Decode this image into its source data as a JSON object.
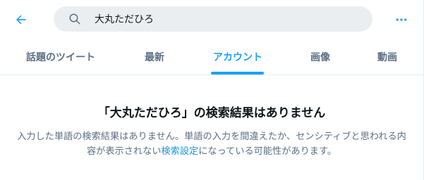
{
  "header": {
    "search_value": "大丸ただひろ",
    "back_icon": "arrow-left-icon",
    "more_icon": "more-horizontal-icon",
    "accent_color": "#1da1f2"
  },
  "tabs": [
    {
      "label": "話題のツイート",
      "active": false
    },
    {
      "label": "最新",
      "active": false
    },
    {
      "label": "アカウント",
      "active": true
    },
    {
      "label": "画像",
      "active": false
    },
    {
      "label": "動画",
      "active": false
    }
  ],
  "empty_state": {
    "title": "「大丸ただひろ」の検索結果はありません",
    "desc_part1": "入力した単語の検索結果はありません。単語の入力を間違えたか、センシティブと思われる内容が表示されない",
    "desc_link": "検索設定",
    "desc_part2": "になっている可能性があります。"
  }
}
